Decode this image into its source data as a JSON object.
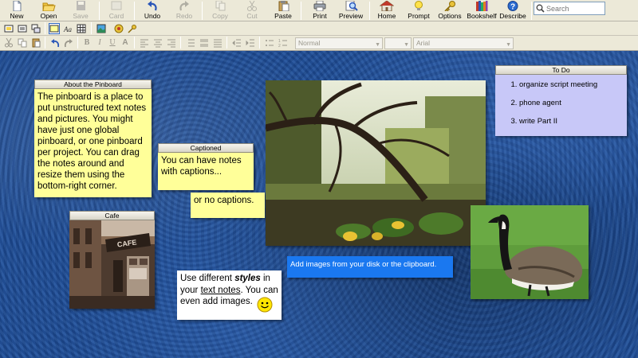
{
  "toolbar": {
    "buttons": [
      {
        "label": "New",
        "icon": "new-page-icon",
        "enabled": true
      },
      {
        "label": "Open",
        "icon": "folder-open-icon",
        "enabled": true
      },
      {
        "label": "Save",
        "icon": "floppy-disk-icon",
        "enabled": false
      },
      {
        "label": "Card",
        "icon": "card-icon",
        "enabled": false
      },
      {
        "label": "Undo",
        "icon": "undo-icon",
        "enabled": true
      },
      {
        "label": "Redo",
        "icon": "redo-icon",
        "enabled": false
      },
      {
        "label": "Copy",
        "icon": "copy-icon",
        "enabled": false
      },
      {
        "label": "Cut",
        "icon": "scissors-icon",
        "enabled": false
      },
      {
        "label": "Paste",
        "icon": "clipboard-icon",
        "enabled": true
      },
      {
        "label": "Print",
        "icon": "printer-icon",
        "enabled": true
      },
      {
        "label": "Preview",
        "icon": "magnifier-page-icon",
        "enabled": true
      },
      {
        "label": "Home",
        "icon": "house-icon",
        "enabled": true
      },
      {
        "label": "Prompt",
        "icon": "lightbulb-icon",
        "enabled": true
      },
      {
        "label": "Options",
        "icon": "key-icon",
        "enabled": true
      },
      {
        "label": "Bookshelf",
        "icon": "books-icon",
        "enabled": true
      },
      {
        "label": "Describe",
        "icon": "question-icon",
        "enabled": true
      }
    ],
    "search_placeholder": "Search"
  },
  "format_toolbar": {
    "style_combo": "Normal",
    "size_combo": "",
    "font_combo": "Arial",
    "bold": "B",
    "italic": "I",
    "underline": "U",
    "text_color": "A"
  },
  "pinboard": {
    "about": {
      "caption": "About the Pinboard",
      "text": "The pinboard is a place to put unstructured text notes and pictures. You might have just one global pinboard, or one pinboard per project. You can drag the notes around and resize them using the bottom-right corner."
    },
    "captioned": {
      "caption": "Captioned",
      "text": "You can have notes with captions..."
    },
    "no_caption": {
      "text": "or no captions."
    },
    "cafe": {
      "caption": "Cafe",
      "sign_text": "CAFE"
    },
    "styles_note": {
      "part1": "Use different ",
      "bold_italic": "styles",
      "part2": " in your ",
      "underlined": "text notes",
      "part3": ". You can even add images."
    },
    "image_caption": "Add images from your disk or the clipboard.",
    "todo": {
      "caption": "To Do",
      "items": [
        "organize script meeting",
        "phone agent",
        "write Part II"
      ]
    }
  },
  "colors": {
    "board": "#1f4f96",
    "note_yellow": "#ffff99",
    "todo_lilac": "#c8c8f8",
    "caption_blue": "#1a78f0"
  }
}
